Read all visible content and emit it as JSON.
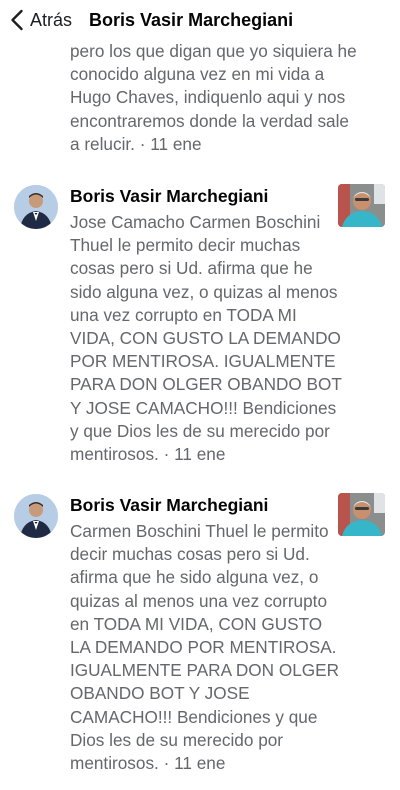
{
  "header": {
    "back_label": "Atrás",
    "title": "Boris Vasir Marchegiani"
  },
  "comments": [
    {
      "text": "pero los que digan que yo siquiera he conocido alguna vez en mi vida a Hugo Chaves, indiquenlo aqui y nos encontraremos donde la verdad sale a relucir.",
      "time": "11 ene"
    },
    {
      "author": "Boris Vasir Marchegiani",
      "text": "Jose Camacho Carmen Boschini Thuel le permito decir muchas cosas pero si Ud. afirma que he sido alguna vez, o quizas al menos una vez corrupto en TODA MI VIDA, CON GUSTO LA DEMANDO POR MENTIROSA. IGUALMENTE PARA DON OLGER OBANDO BOT Y JOSE CAMACHO!!! Bendiciones y que Dios les de su merecido por mentirosos.",
      "time": "11 ene"
    },
    {
      "author": "Boris Vasir Marchegiani",
      "text": "Carmen Boschini Thuel le permito decir muchas cosas pero si Ud. afirma que he sido alguna vez, o quizas al menos una vez corrupto en TODA MI VIDA, CON GUSTO LA DEMANDO POR MENTIROSA. IGUALMENTE PARA DON OLGER OBANDO BOT Y JOSE CAMACHO!!! Bendiciones y que Dios les de su merecido por mentirosos.",
      "time": "11 ene"
    }
  ],
  "separator": " · ",
  "icons": {
    "back": "chevron-left-icon",
    "avatar": "profile-photo",
    "thumb": "attached-photo"
  }
}
